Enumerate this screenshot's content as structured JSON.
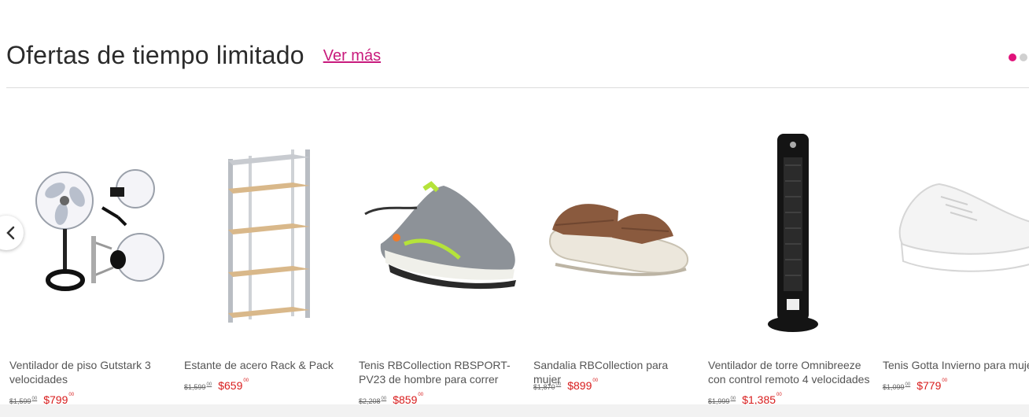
{
  "section": {
    "title": "Ofertas de tiempo limitado",
    "see_more": "Ver más"
  },
  "carousel": {
    "dots": [
      {
        "active": true
      },
      {
        "active": false
      }
    ],
    "prev_icon": "chevron-left-icon"
  },
  "products": [
    {
      "name": "Ventilador de piso Gutstark 3 velocidades",
      "old_price": "$1,599",
      "old_cents": "00",
      "price": "$799",
      "price_cents": "00",
      "image": "pedestal-fan-set"
    },
    {
      "name": "Estante de acero Rack & Pack",
      "old_price": "$1,599",
      "old_cents": "00",
      "price": "$659",
      "price_cents": "00",
      "image": "steel-shelf"
    },
    {
      "name": "Tenis RBCollection RBSPORT-PV23 de hombre para correr",
      "old_price": "$2,208",
      "old_cents": "00",
      "price": "$859",
      "price_cents": "00",
      "image": "running-shoe"
    },
    {
      "name": "Sandalia RBCollection para mujer",
      "old_price": "$1,870",
      "old_cents": "00",
      "price": "$899",
      "price_cents": "00",
      "image": "sandal"
    },
    {
      "name": "Ventilador de torre Omnibreeze con control remoto 4 velocidades",
      "old_price": "$1,999",
      "old_cents": "00",
      "price": "$1,385",
      "price_cents": "00",
      "image": "tower-fan"
    },
    {
      "name": "Tenis Gotta Invierno para mujer",
      "old_price": "$1,099",
      "old_cents": "00",
      "price": "$779",
      "price_cents": "00",
      "image": "white-sneaker"
    }
  ],
  "colors": {
    "accent": "#c81a7c",
    "dot_active": "#e0127a",
    "price": "#d81c1c"
  }
}
